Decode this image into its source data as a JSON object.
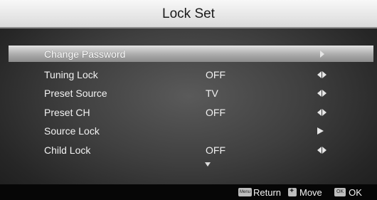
{
  "title": "Lock Set",
  "menu": {
    "items": [
      {
        "label": "Change Password",
        "value": "",
        "control": "right-arrow-icon",
        "selected": true
      },
      {
        "label": "Tuning Lock",
        "value": "OFF",
        "control": "left-right-arrows-icon",
        "selected": false
      },
      {
        "label": "Preset Source",
        "value": "TV",
        "control": "left-right-arrows-icon",
        "selected": false
      },
      {
        "label": "Preset CH",
        "value": "OFF",
        "control": "left-right-arrows-icon",
        "selected": false
      },
      {
        "label": "Source Lock",
        "value": "",
        "control": "right-arrow-icon",
        "selected": false
      },
      {
        "label": "Child Lock",
        "value": "OFF",
        "control": "left-right-arrows-icon",
        "selected": false
      }
    ]
  },
  "footer": {
    "menu_key": "Menu",
    "return_label": "Return",
    "move_label": "Move",
    "ok_key": "OK",
    "ok_label": "OK"
  }
}
